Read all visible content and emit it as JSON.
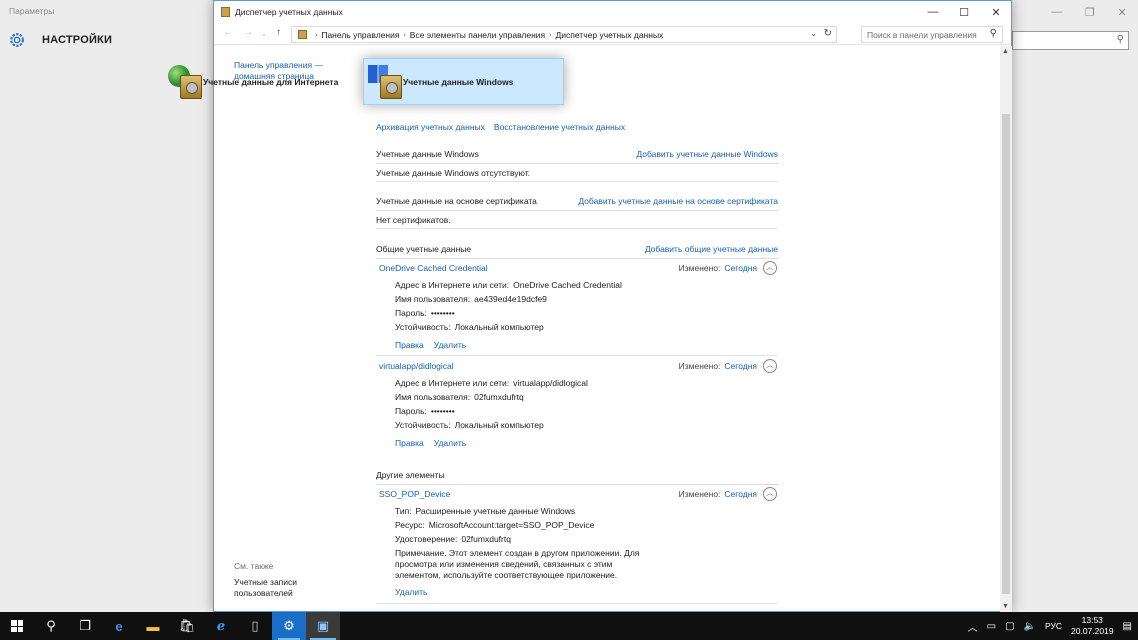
{
  "background_window": {
    "title": "Параметры",
    "heading": "НАСТРОЙКИ",
    "search_icon": "search-icon"
  },
  "window": {
    "title": "Диспетчер учетных данных",
    "controls": {
      "minimize": "—",
      "maximize": "☐",
      "close": "✕"
    }
  },
  "address": {
    "crumbs": [
      "Панель управления",
      "Все элементы панели управления",
      "Диспетчер учетных данных"
    ],
    "search_placeholder": "Поиск в панели управления"
  },
  "sidebar": {
    "home_link": "Панель управления — домашняя страница",
    "see_also": "См. также",
    "user_accounts": "Учетные записи пользователей"
  },
  "tiles": {
    "internet": "Учетные данные для Интернета",
    "windows": "Учетные данные Windows"
  },
  "top_links": {
    "backup": "Архивация учетных данных",
    "restore": "Восстановление учетных данных"
  },
  "sections": {
    "windows_creds": {
      "title": "Учетные данные Windows",
      "add": "Добавить учетные данные Windows",
      "empty": "Учетные данные Windows отсутствуют."
    },
    "cert_creds": {
      "title": "Учетные данные на основе сертификата",
      "add": "Добавить учетные данные на основе сертификата",
      "empty": "Нет сертификатов."
    },
    "generic_creds": {
      "title": "Общие учетные данные",
      "add": "Добавить общие учетные данные"
    },
    "other": {
      "title": "Другие элементы"
    }
  },
  "labels": {
    "address": "Адрес в Интернете или сети:",
    "username": "Имя пользователя:",
    "password": "Пароль:",
    "persistence": "Устойчивость:",
    "modified": "Изменено:",
    "edit": "Правка",
    "delete": "Удалить",
    "type": "Тип:",
    "resource": "Ресурс:",
    "identity": "Удостоверение:"
  },
  "credentials": [
    {
      "name": "OneDrive Cached Credential",
      "modified": "Сегодня",
      "address": "OneDrive Cached Credential",
      "username": "ae439ed4e19dcfe9",
      "password": "••••••••",
      "persistence": "Локальный компьютер"
    },
    {
      "name": "virtualapp/didlogical",
      "modified": "Сегодня",
      "address": "virtualapp/didlogical",
      "username": "02fumxdufrtq",
      "password": "••••••••",
      "persistence": "Локальный компьютер"
    }
  ],
  "other_item": {
    "name": "SSO_POP_Device",
    "modified": "Сегодня",
    "type": "Расширенные учетные данные Windows",
    "resource": "MicrosoftAccount:target=SSO_POP_Device",
    "identity": "02fumxdufrtq",
    "note": "Примечание. Этот элемент создан в другом приложении. Для просмотра или изменения сведений, связанных с этим элементом, используйте соответствующее приложение."
  },
  "taskbar": {
    "time": "13:53",
    "date": "20.07.2019",
    "lang": "РУС",
    "icons": [
      "start-icon",
      "search-icon",
      "task-view-icon",
      "edge-icon",
      "file-explorer-icon",
      "store-icon",
      "ie-icon",
      "notepad-icon",
      "settings-icon",
      "control-panel-icon"
    ]
  },
  "colors": {
    "link": "#1a5fb4",
    "selected_tile": "#cce8ff",
    "taskbar": "#101010",
    "accent": "#76b9ed"
  }
}
